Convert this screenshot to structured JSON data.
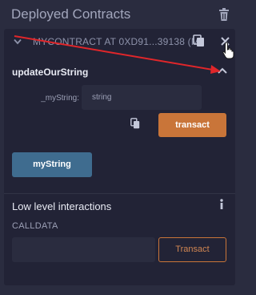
{
  "header": {
    "title": "Deployed Contracts",
    "trash_icon": "trash-icon"
  },
  "contract": {
    "name": "MYCONTRACT AT 0XD91...39138 (M",
    "chevron_icon": "chevron-down-icon",
    "copy_icon": "copy-icon",
    "close_icon": "close-icon"
  },
  "function": {
    "name": "updateOurString",
    "collapse_icon": "chevron-up-icon",
    "param_label": "_myString:",
    "param_placeholder": "string",
    "transact_label": "transact",
    "copy_icon": "copy-icon"
  },
  "call_button": {
    "label": "myString"
  },
  "low_level": {
    "title": "Low level interactions",
    "info_icon": "info-icon",
    "calldata_label": "CALLDATA",
    "calldata_value": "",
    "transact_label": "Transact"
  },
  "colors": {
    "background": "#2a2c3f",
    "panel": "#222336",
    "transact": "#c97539",
    "call": "#3f6c8f",
    "annotation_arrow": "#e0262a"
  }
}
